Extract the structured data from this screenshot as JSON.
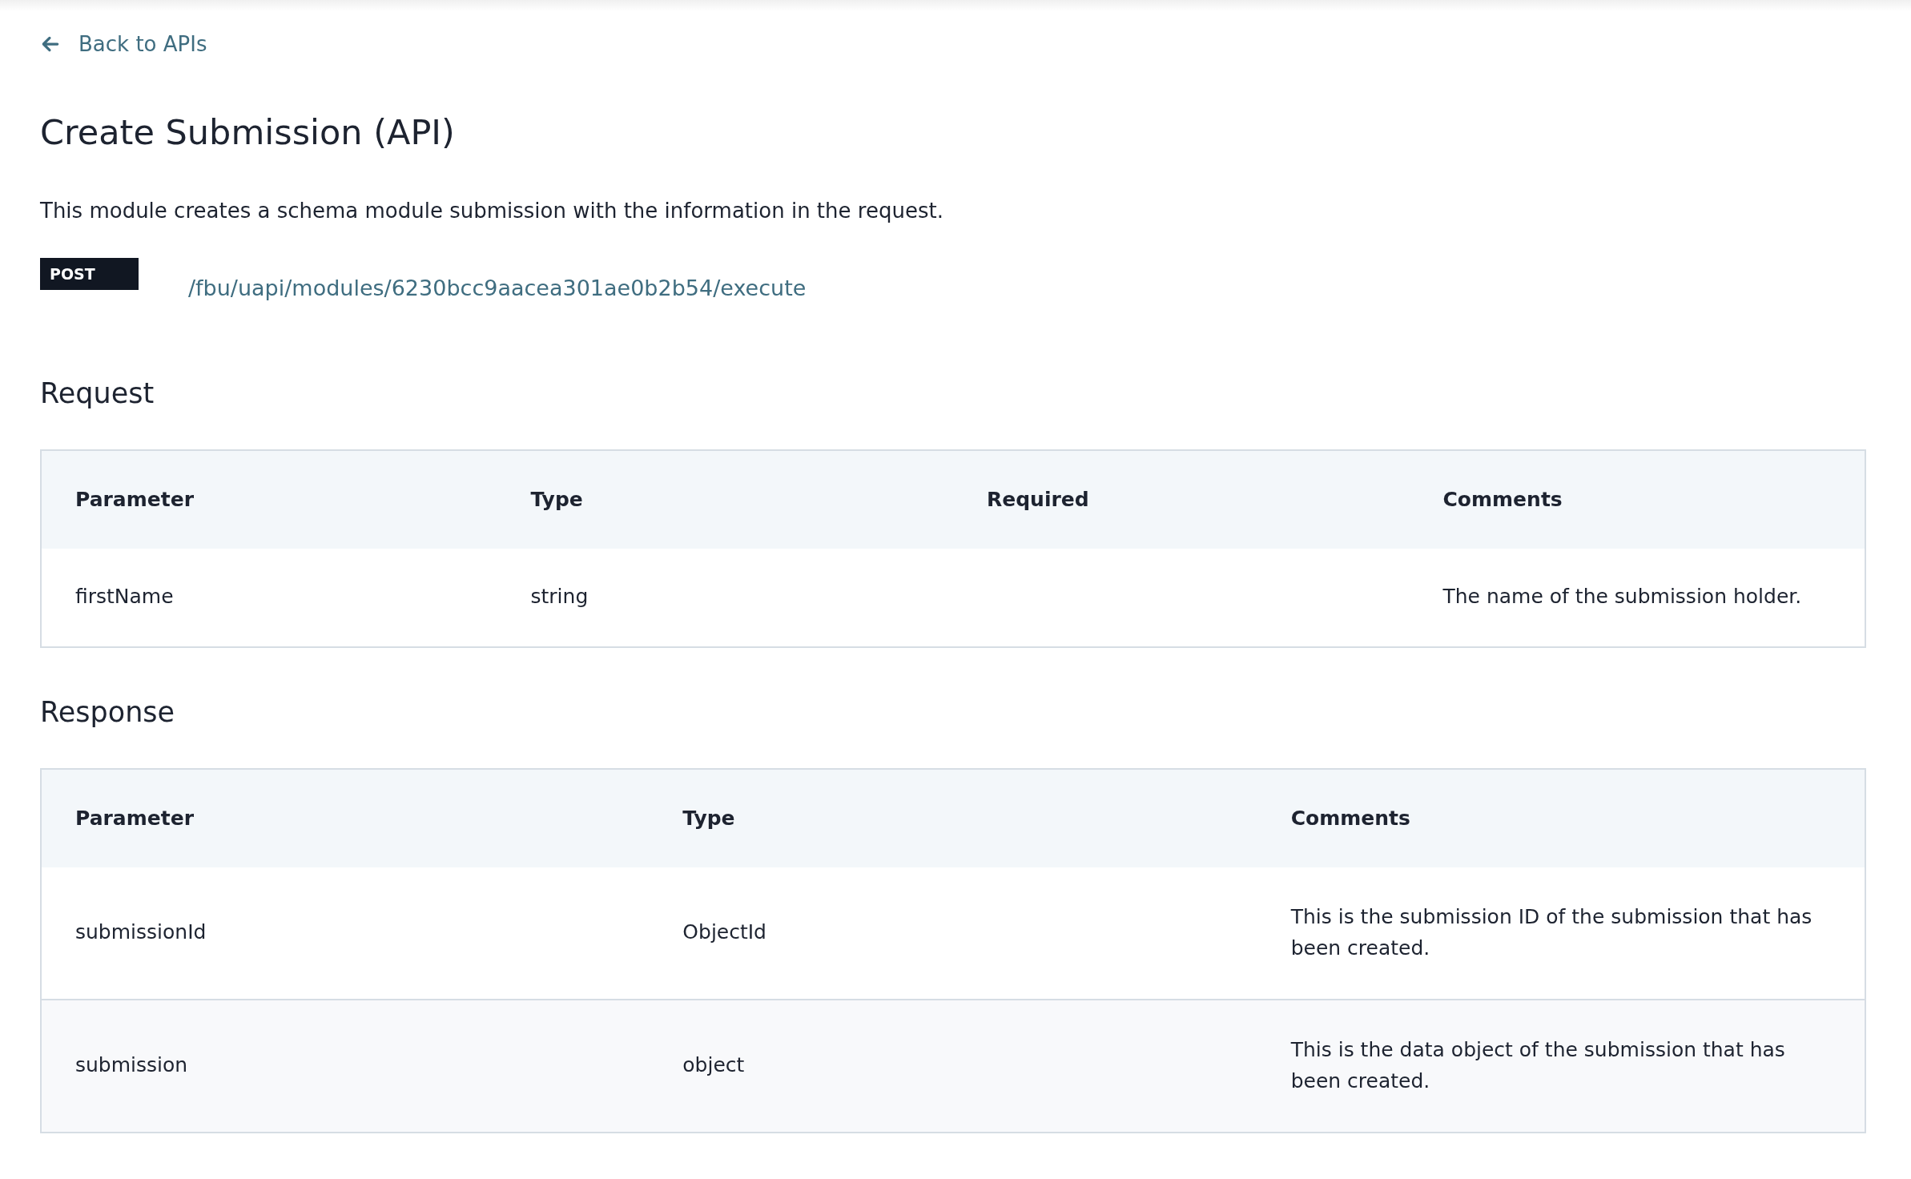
{
  "back_link": {
    "label": "Back to APIs"
  },
  "title": "Create Submission (API)",
  "description": "This module creates a schema module submission with the information in the request.",
  "endpoint": {
    "method": "POST",
    "path": "/fbu/uapi/modules/6230bcc9aacea301ae0b2b54/execute"
  },
  "sections": [
    {
      "heading": "Request",
      "table": {
        "columns": [
          "Parameter",
          "Type",
          "Required",
          "Comments"
        ],
        "rows": [
          [
            "firstName",
            "string",
            "",
            "The name of the submission holder."
          ]
        ]
      }
    },
    {
      "heading": "Response",
      "table": {
        "columns": [
          "Parameter",
          "Type",
          "Comments"
        ],
        "rows": [
          [
            "submissionId",
            "ObjectId",
            "This is the submission ID of the submission that has been created."
          ],
          [
            "submission",
            "object",
            "This is the data object of the submission that has been created."
          ]
        ]
      }
    }
  ]
}
